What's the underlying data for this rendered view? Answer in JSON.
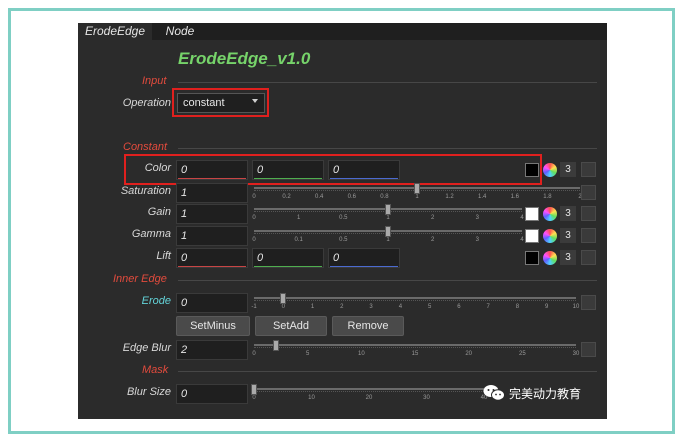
{
  "tabs": [
    "ErodeEdge",
    "Node"
  ],
  "node_title": "ErodeEdge_v1.0",
  "sections": {
    "input": "Input",
    "constant": "Constant",
    "inner_edge": "Inner Edge",
    "mask": "Mask"
  },
  "operation": {
    "label": "Operation",
    "value": "constant"
  },
  "color": {
    "label": "Color",
    "values": [
      "0",
      "0",
      "0"
    ],
    "swatch": "#000000",
    "count": "3"
  },
  "saturation": {
    "label": "Saturation",
    "value": "1",
    "ticks": [
      "0",
      "0.2",
      "0.4",
      "0.6",
      "0.8",
      "1",
      "1.2",
      "1.4",
      "1.6",
      "1.8",
      "2"
    ]
  },
  "gain": {
    "label": "Gain",
    "value": "1",
    "ticks": [
      "0",
      "1",
      "0.5",
      "1",
      "2",
      "3",
      "4"
    ],
    "swatch": "#ffffff",
    "count": "3"
  },
  "gamma": {
    "label": "Gamma",
    "value": "1",
    "ticks": [
      "0",
      "0.1",
      "0.5",
      "1",
      "2",
      "3",
      "4"
    ],
    "swatch": "#ffffff",
    "count": "3"
  },
  "lift": {
    "label": "Lift",
    "values": [
      "0",
      "0",
      "0"
    ],
    "swatch": "#000000",
    "count": "3"
  },
  "erode": {
    "label": "Erode",
    "value": "0",
    "ticks": [
      "-1",
      "0",
      "1",
      "2",
      "3",
      "4",
      "5",
      "6",
      "7",
      "8",
      "9",
      "10"
    ]
  },
  "buttons": {
    "set_minus": "SetMinus",
    "set_add": "SetAdd",
    "remove": "Remove"
  },
  "edge_blur": {
    "label": "Edge Blur",
    "value": "2",
    "ticks": [
      "0",
      "5",
      "10",
      "15",
      "20",
      "25",
      "30"
    ]
  },
  "blur_size": {
    "label": "Blur Size",
    "value": "0",
    "ticks": [
      "0",
      "10",
      "20",
      "30",
      "40"
    ]
  },
  "watermark": "完美动力教育",
  "colors": {
    "accent_green": "#76d36a",
    "section_red": "#e24b3d",
    "erode_cyan": "#63d3d8",
    "highlight_red": "#e0201e"
  }
}
